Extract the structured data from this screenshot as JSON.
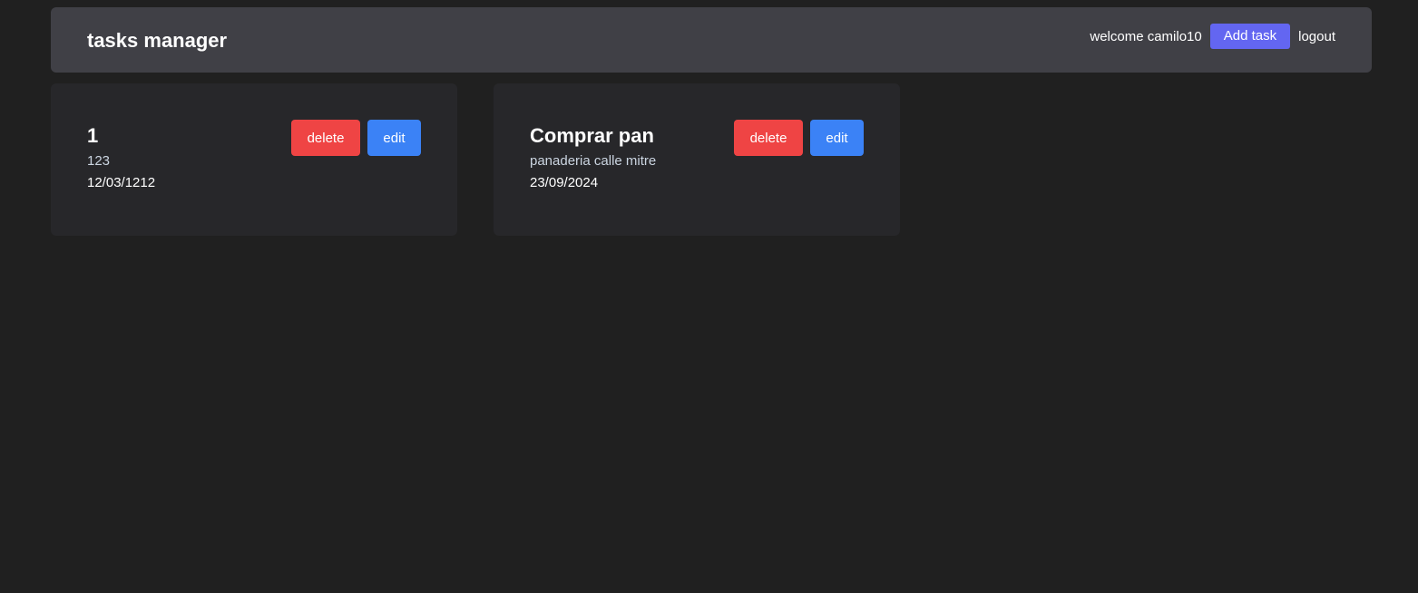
{
  "navbar": {
    "brand": "tasks manager",
    "welcome": "welcome camilo10",
    "add_task_label": "Add task",
    "logout_label": "logout"
  },
  "tasks": [
    {
      "title": "1",
      "description": "123",
      "date": "12/03/1212",
      "delete_label": "delete",
      "edit_label": "edit"
    },
    {
      "title": "Comprar pan",
      "description": "panaderia calle mitre",
      "date": "23/09/2024",
      "delete_label": "delete",
      "edit_label": "edit"
    }
  ],
  "colors": {
    "background": "#202020",
    "navbar": "#404046",
    "card": "#27272a",
    "add_task": "#6366f1",
    "delete": "#ef4444",
    "edit": "#3b82f6"
  }
}
